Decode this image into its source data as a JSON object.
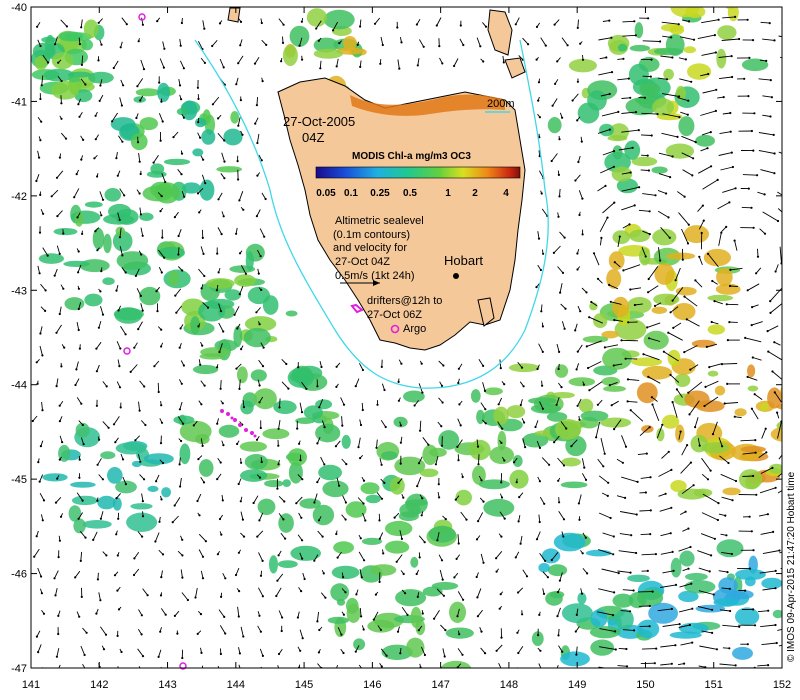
{
  "map": {
    "lon_range": [
      141,
      152
    ],
    "lat_range": [
      -47,
      -40
    ],
    "x_ticks": [
      "141",
      "142",
      "143",
      "144",
      "145",
      "146",
      "147",
      "148",
      "149",
      "150",
      "151",
      "152"
    ],
    "y_ticks": [
      "-40",
      "-41",
      "-42",
      "-43",
      "-44",
      "-45",
      "-46",
      "-47"
    ]
  },
  "labels": {
    "date": "27-Oct-2005",
    "time": "04Z",
    "depth_contour": "200m",
    "colorbar_title": "MODIS Chl-a mg/m3 OC3",
    "colorbar_ticks": [
      "0.05",
      "0.1",
      "0.25",
      "0.5",
      "1",
      "2",
      "4"
    ],
    "altimetry_lines": [
      "Altimetric sealevel",
      "(0.1m contours)",
      "and velocity for",
      "27-Oct 04Z",
      "0.5m/s (1kt 24h)"
    ],
    "city": "Hobart",
    "drifter_lines": [
      "drifters@12h to",
      "27-Oct 06Z"
    ],
    "argo": "Argo",
    "credit": "© IMOS 09-Apr-2015 21:47:20 Hobart time"
  },
  "colors": {
    "land": "#f5c89a",
    "shelf_contour": "#40d8e8",
    "drifter": "#e020e0",
    "argo": "#e020e0"
  }
}
